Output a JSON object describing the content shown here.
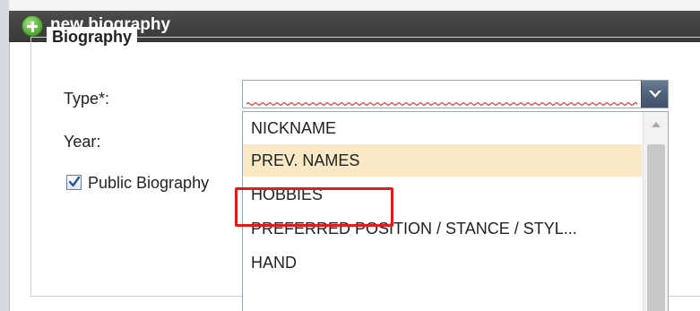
{
  "window": {
    "title": "new biography",
    "title_icon": "add-circle-icon"
  },
  "fieldset": {
    "legend": "Biography"
  },
  "form": {
    "type_label": "Type*:",
    "type_value": "",
    "year_label": "Year:",
    "public_checkbox": {
      "label": "Public Biography",
      "checked": true
    }
  },
  "dropdown": {
    "items": [
      "NICKNAME",
      "PREV. NAMES",
      "HOBBIES",
      "PREFERRED POSITION / STANCE / STYL...",
      "HAND"
    ],
    "selected_index": 1
  },
  "colors": {
    "titlebar": "#444444",
    "selection": "#fbe9c6",
    "highlight": "#e21b1b",
    "invalid": "#e03c3c"
  }
}
